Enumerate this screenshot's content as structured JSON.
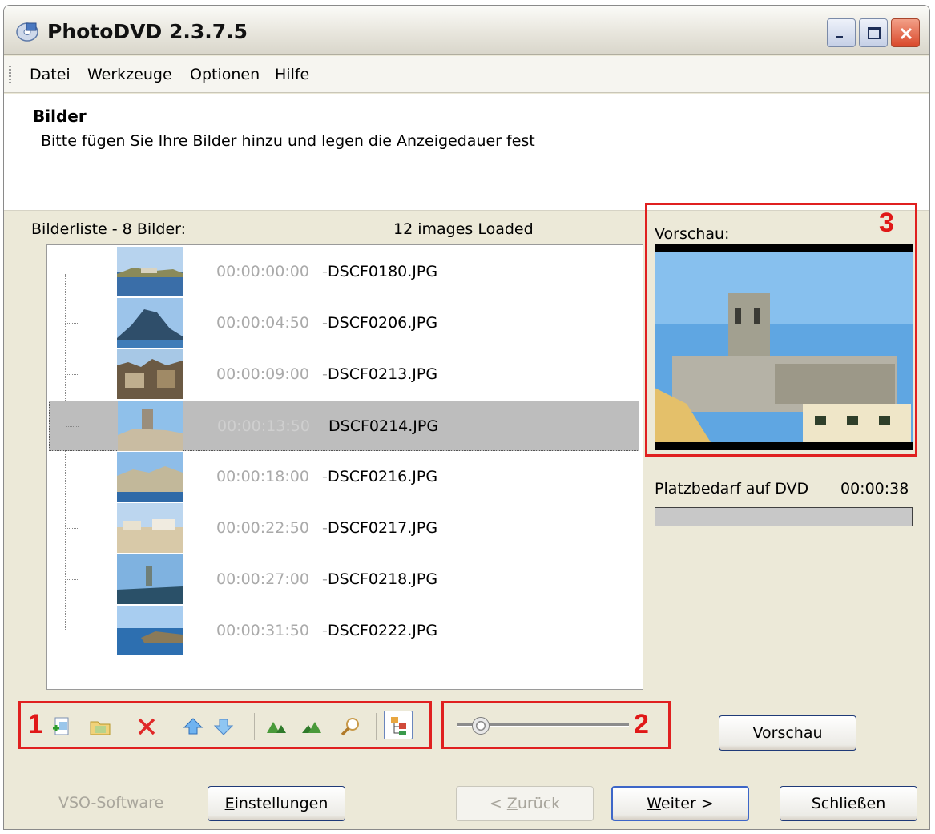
{
  "window": {
    "title": "PhotoDVD 2.3.7.5",
    "controls": [
      "minimize-icon",
      "maximize-icon",
      "close-icon"
    ]
  },
  "menu": {
    "items": [
      "Datei",
      "Werkzeuge",
      "Optionen",
      "Hilfe"
    ]
  },
  "header": {
    "title": "Bilder",
    "subtitle": "Bitte fügen Sie Ihre Bilder hinzu und legen die Anzeigedauer fest"
  },
  "list": {
    "label": "Bilderliste - 8 Bilder:",
    "status": "12 images Loaded",
    "separator": " - ",
    "items": [
      {
        "time": "00:00:00:00",
        "file": "DSCF0180.JPG",
        "selected": false
      },
      {
        "time": "00:00:04:50",
        "file": "DSCF0206.JPG",
        "selected": false
      },
      {
        "time": "00:00:09:00",
        "file": "DSCF0213.JPG",
        "selected": false
      },
      {
        "time": "00:00:13:50",
        "file": "DSCF0214.JPG",
        "selected": true
      },
      {
        "time": "00:00:18:00",
        "file": "DSCF0216.JPG",
        "selected": false
      },
      {
        "time": "00:00:22:50",
        "file": "DSCF0217.JPG",
        "selected": false
      },
      {
        "time": "00:00:27:00",
        "file": "DSCF0218.JPG",
        "selected": false
      },
      {
        "time": "00:00:31:50",
        "file": "DSCF0222.JPG",
        "selected": false
      }
    ]
  },
  "preview": {
    "label": "Vorschau:",
    "space_label": "Platzbedarf auf DVD",
    "duration": "00:00:38",
    "usage_fraction": 0.0
  },
  "toolbar": {
    "icons": [
      "add-image-icon",
      "add-folder-icon",
      "delete-icon",
      "move-up-icon",
      "move-down-icon",
      "rotate-left-icon",
      "rotate-right-icon",
      "zoom-icon",
      "tree-view-icon"
    ]
  },
  "slider": {
    "value_fraction": 0.1
  },
  "annotations": {
    "markers": [
      "1",
      "2",
      "3"
    ]
  },
  "buttons": {
    "preview": "Vorschau",
    "settings": "Einstellungen",
    "back": "< Zurück",
    "next": "Weiter >",
    "close": "Schließen"
  },
  "brand": "VSO-Software",
  "colors": {
    "annotation_red": "#e02020",
    "selection_gray": "#bdbdbd",
    "time_gray": "#aaaaaa",
    "accent_blue": "#3d66c8"
  }
}
